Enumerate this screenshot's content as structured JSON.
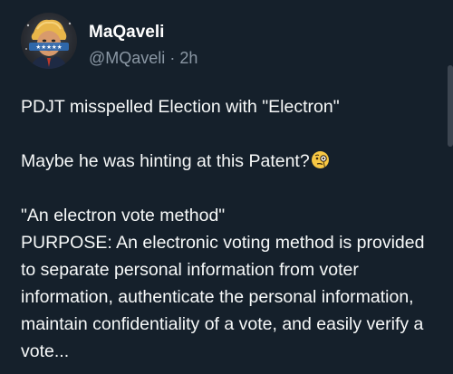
{
  "post": {
    "author": {
      "display_name": "MaQaveli",
      "handle": "@MQaveli",
      "separator": "·",
      "timestamp": "2h",
      "avatar_icon": "avatar-image"
    },
    "paragraphs": [
      "PDJT misspelled Election with \"Electron\"",
      "Maybe he was hinting at this Patent?",
      "\"An electron vote method\"",
      "PURPOSE: An electronic voting method is provided to separate personal information from voter information, authenticate the personal information, maintain confidentiality of a vote, and easily verify a vote..."
    ],
    "emoji_icon": "face-with-monocle-icon"
  }
}
